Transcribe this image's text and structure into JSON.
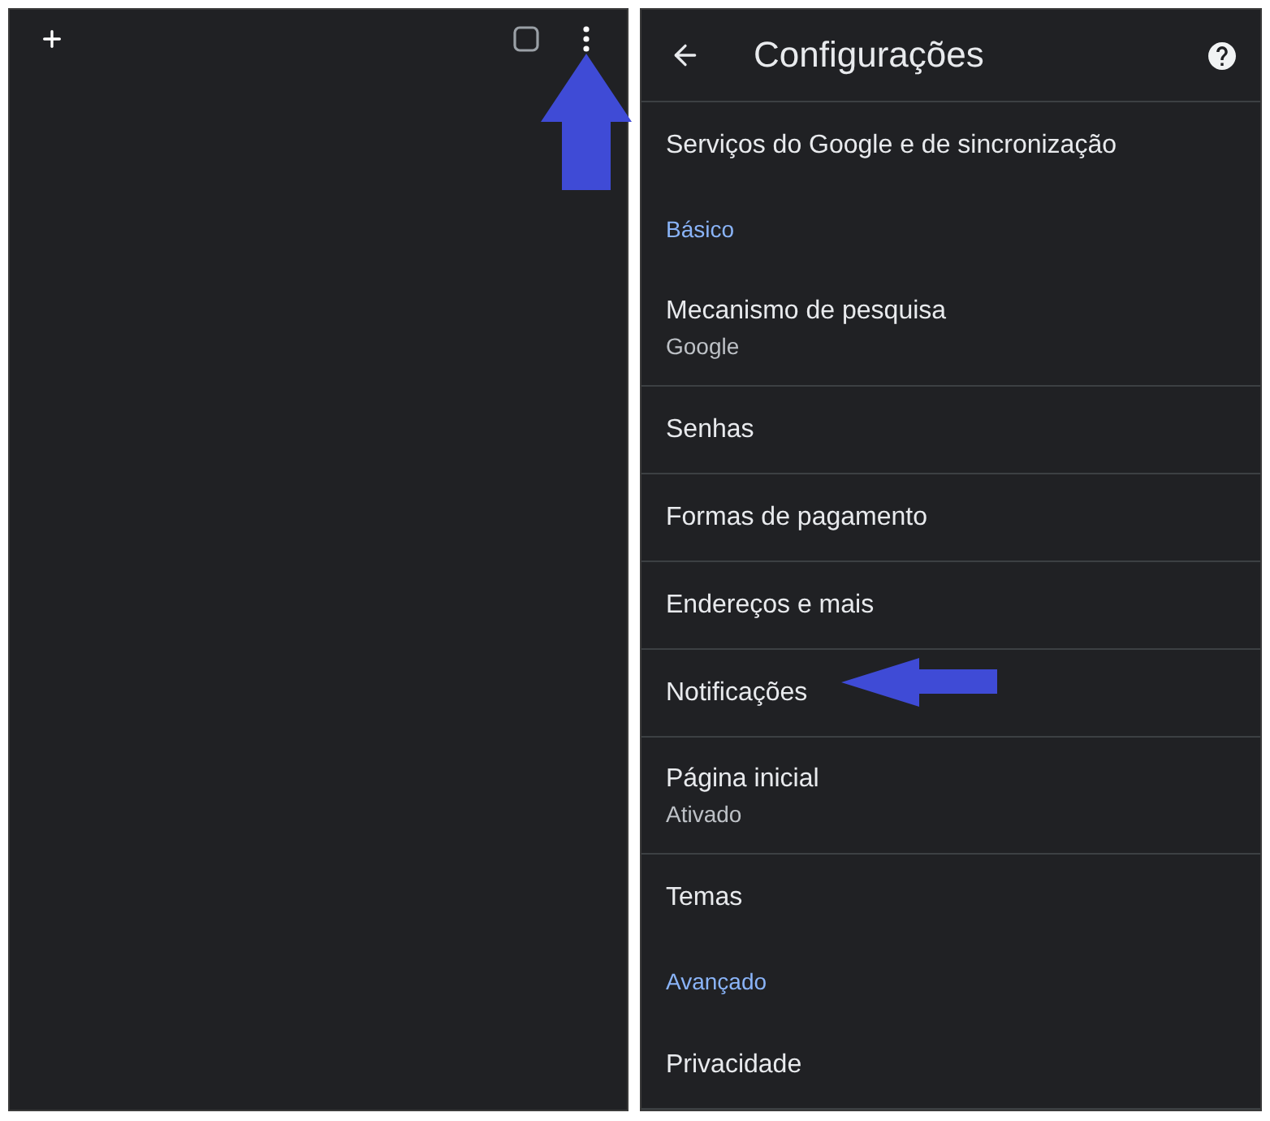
{
  "settings": {
    "title": "Configurações",
    "items": [
      {
        "kind": "item",
        "label": "Serviços do Google e de sincronização"
      },
      {
        "kind": "section",
        "label": "Básico"
      },
      {
        "kind": "item",
        "label": "Mecanismo de pesquisa",
        "summary": "Google"
      },
      {
        "kind": "item",
        "label": "Senhas"
      },
      {
        "kind": "item",
        "label": "Formas de pagamento"
      },
      {
        "kind": "item",
        "label": "Endereços e mais"
      },
      {
        "kind": "item",
        "label": "Notificações"
      },
      {
        "kind": "item",
        "label": "Página inicial",
        "summary": "Ativado"
      },
      {
        "kind": "item",
        "label": "Temas"
      },
      {
        "kind": "section",
        "label": "Avançado"
      },
      {
        "kind": "item",
        "label": "Privacidade"
      }
    ]
  }
}
